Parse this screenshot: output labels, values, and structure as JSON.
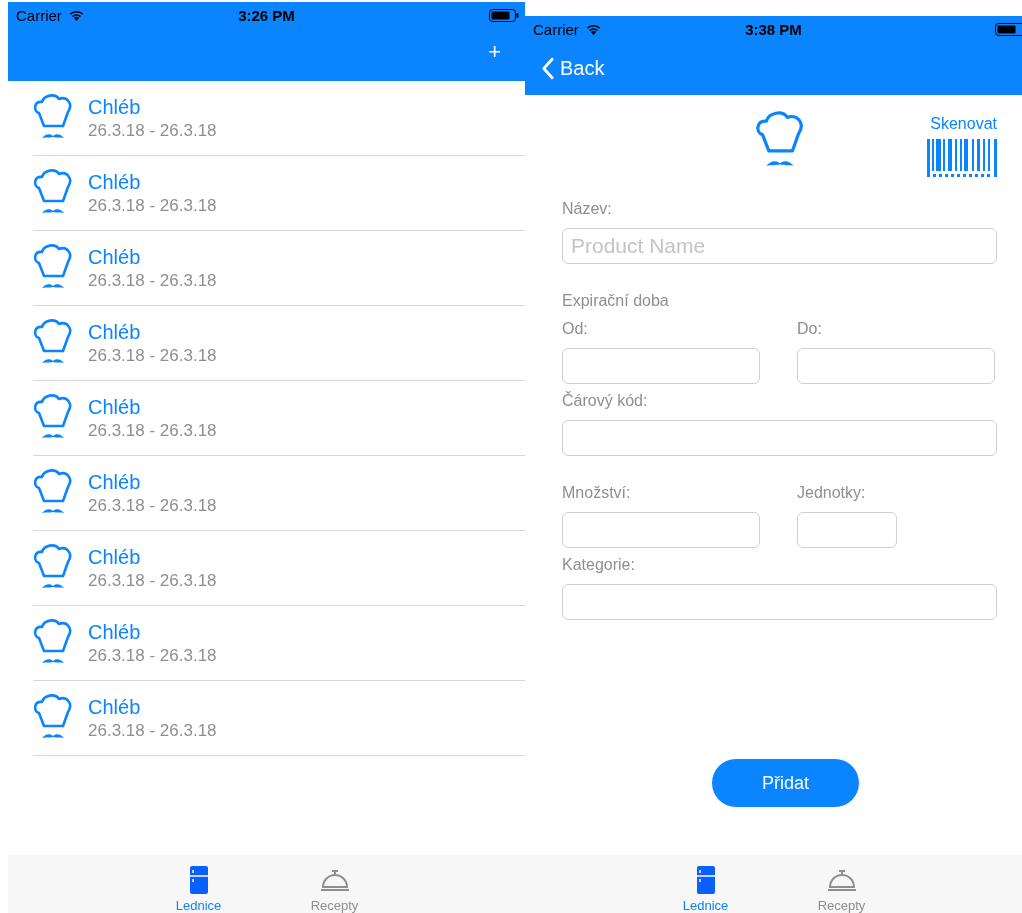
{
  "list_screen": {
    "status_bar": {
      "carrier": "Carrier",
      "time": "3:26 PM"
    },
    "nav": {
      "add": "+"
    },
    "items": [
      {
        "name": "Chléb",
        "dates": "26.3.18 - 26.3.18"
      },
      {
        "name": "Chléb",
        "dates": "26.3.18 - 26.3.18"
      },
      {
        "name": "Chléb",
        "dates": "26.3.18 - 26.3.18"
      },
      {
        "name": "Chléb",
        "dates": "26.3.18 - 26.3.18"
      },
      {
        "name": "Chléb",
        "dates": "26.3.18 - 26.3.18"
      },
      {
        "name": "Chléb",
        "dates": "26.3.18 - 26.3.18"
      },
      {
        "name": "Chléb",
        "dates": "26.3.18 - 26.3.18"
      },
      {
        "name": "Chléb",
        "dates": "26.3.18 - 26.3.18"
      },
      {
        "name": "Chléb",
        "dates": "26.3.18 - 26.3.18"
      }
    ],
    "tabs": [
      {
        "label": "Lednice",
        "kind": "fridge",
        "selected": true
      },
      {
        "label": "Recepty",
        "kind": "cloche",
        "selected": false
      }
    ]
  },
  "form_screen": {
    "status_bar": {
      "carrier": "Carrier",
      "time": "3:38 PM"
    },
    "nav": {
      "back": "Back"
    },
    "scan": "Skenovat",
    "rows": [
      {
        "fields": [
          {
            "label": "Název:",
            "placeholder": "Product Name",
            "kind": "full"
          }
        ]
      },
      {
        "heading": "Expirační doba",
        "fields": [
          {
            "label": "Od:",
            "kind": "half"
          },
          {
            "label": "Do:",
            "kind": "half"
          }
        ]
      },
      {
        "fields": [
          {
            "label": "Čárový kód:",
            "kind": "full"
          }
        ]
      },
      {
        "fields": [
          {
            "label": "Množství:",
            "kind": "half"
          },
          {
            "label": "Jednotky:",
            "kind": "small"
          }
        ]
      },
      {
        "fields": [
          {
            "label": "Kategorie:",
            "kind": "full"
          }
        ]
      }
    ],
    "submit": "Přidat",
    "tabs": [
      {
        "label": "Lednice",
        "kind": "fridge",
        "selected": true
      },
      {
        "label": "Recepty",
        "kind": "cloche",
        "selected": false
      }
    ]
  }
}
